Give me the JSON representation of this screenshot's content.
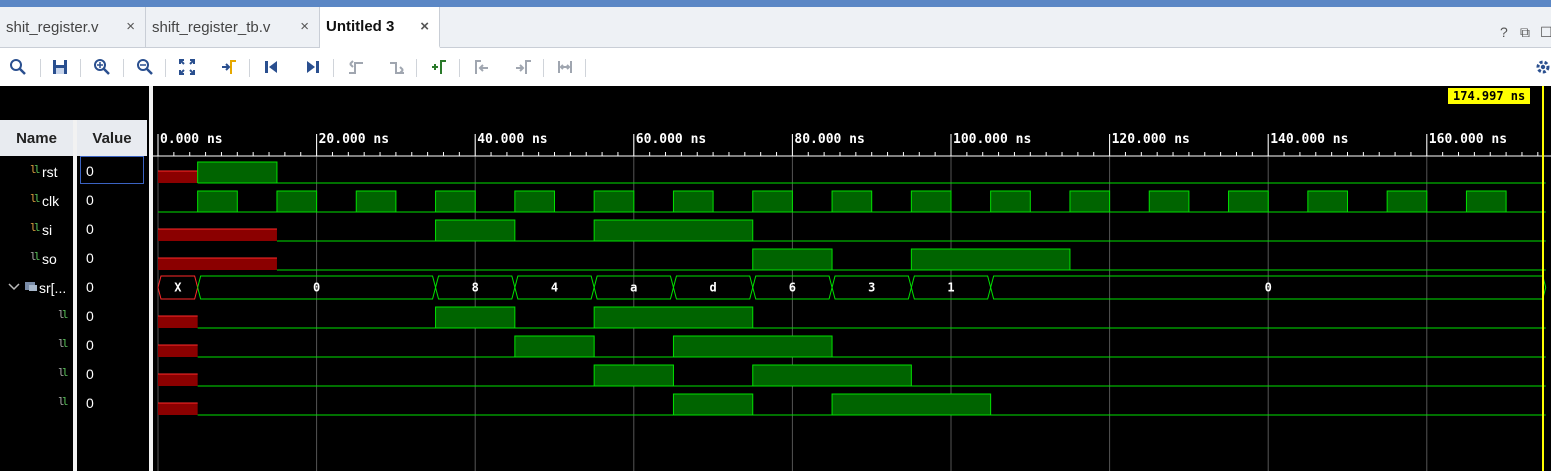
{
  "tabs": [
    {
      "label": "shit_register.v",
      "close": "×"
    },
    {
      "label": "shift_register_tb.v",
      "close": "×"
    },
    {
      "label": "Untitled 3",
      "close": "×"
    }
  ],
  "window_controls": {
    "help": "?",
    "restore": "⧉",
    "maximize": "☐"
  },
  "toolbar": [
    "search-icon",
    "save-icon",
    "zoom-in-icon",
    "zoom-out-icon",
    "zoom-fit-icon",
    "go-to-cursor-icon",
    "go-to-time-zero-icon",
    "go-to-last-time-icon",
    "previous-transition-icon",
    "next-transition-icon",
    "add-marker-icon",
    "previous-marker-icon",
    "next-marker-icon",
    "swap-cursors-icon",
    "settings-icon"
  ],
  "wave": {
    "name_header": "Name",
    "value_header": "Value",
    "cursor_time": "174.997 ns",
    "time_labels": [
      "0.000 ns",
      "20.000 ns",
      "40.000 ns",
      "60.000 ns",
      "80.000 ns",
      "100.000 ns",
      "120.000 ns",
      "140.000 ns",
      "160.000 ns"
    ],
    "signals": [
      {
        "name": "rst",
        "value": "0"
      },
      {
        "name": "clk",
        "value": "0"
      },
      {
        "name": "si",
        "value": "0"
      },
      {
        "name": "so",
        "value": "0"
      },
      {
        "name": "sr[...",
        "value": "0"
      },
      {
        "name": "",
        "value": "0"
      },
      {
        "name": "",
        "value": "0"
      },
      {
        "name": "",
        "value": "0"
      },
      {
        "name": "",
        "value": "0"
      }
    ],
    "bus_values": [
      "X",
      "0",
      "8",
      "4",
      "a",
      "d",
      "6",
      "3",
      "1",
      "0"
    ],
    "colors": {
      "high": "#006400",
      "line": "#00e000",
      "undef": "#8b0000",
      "undef_line": "#ff2a2a",
      "cursor": "#ffff00"
    }
  }
}
